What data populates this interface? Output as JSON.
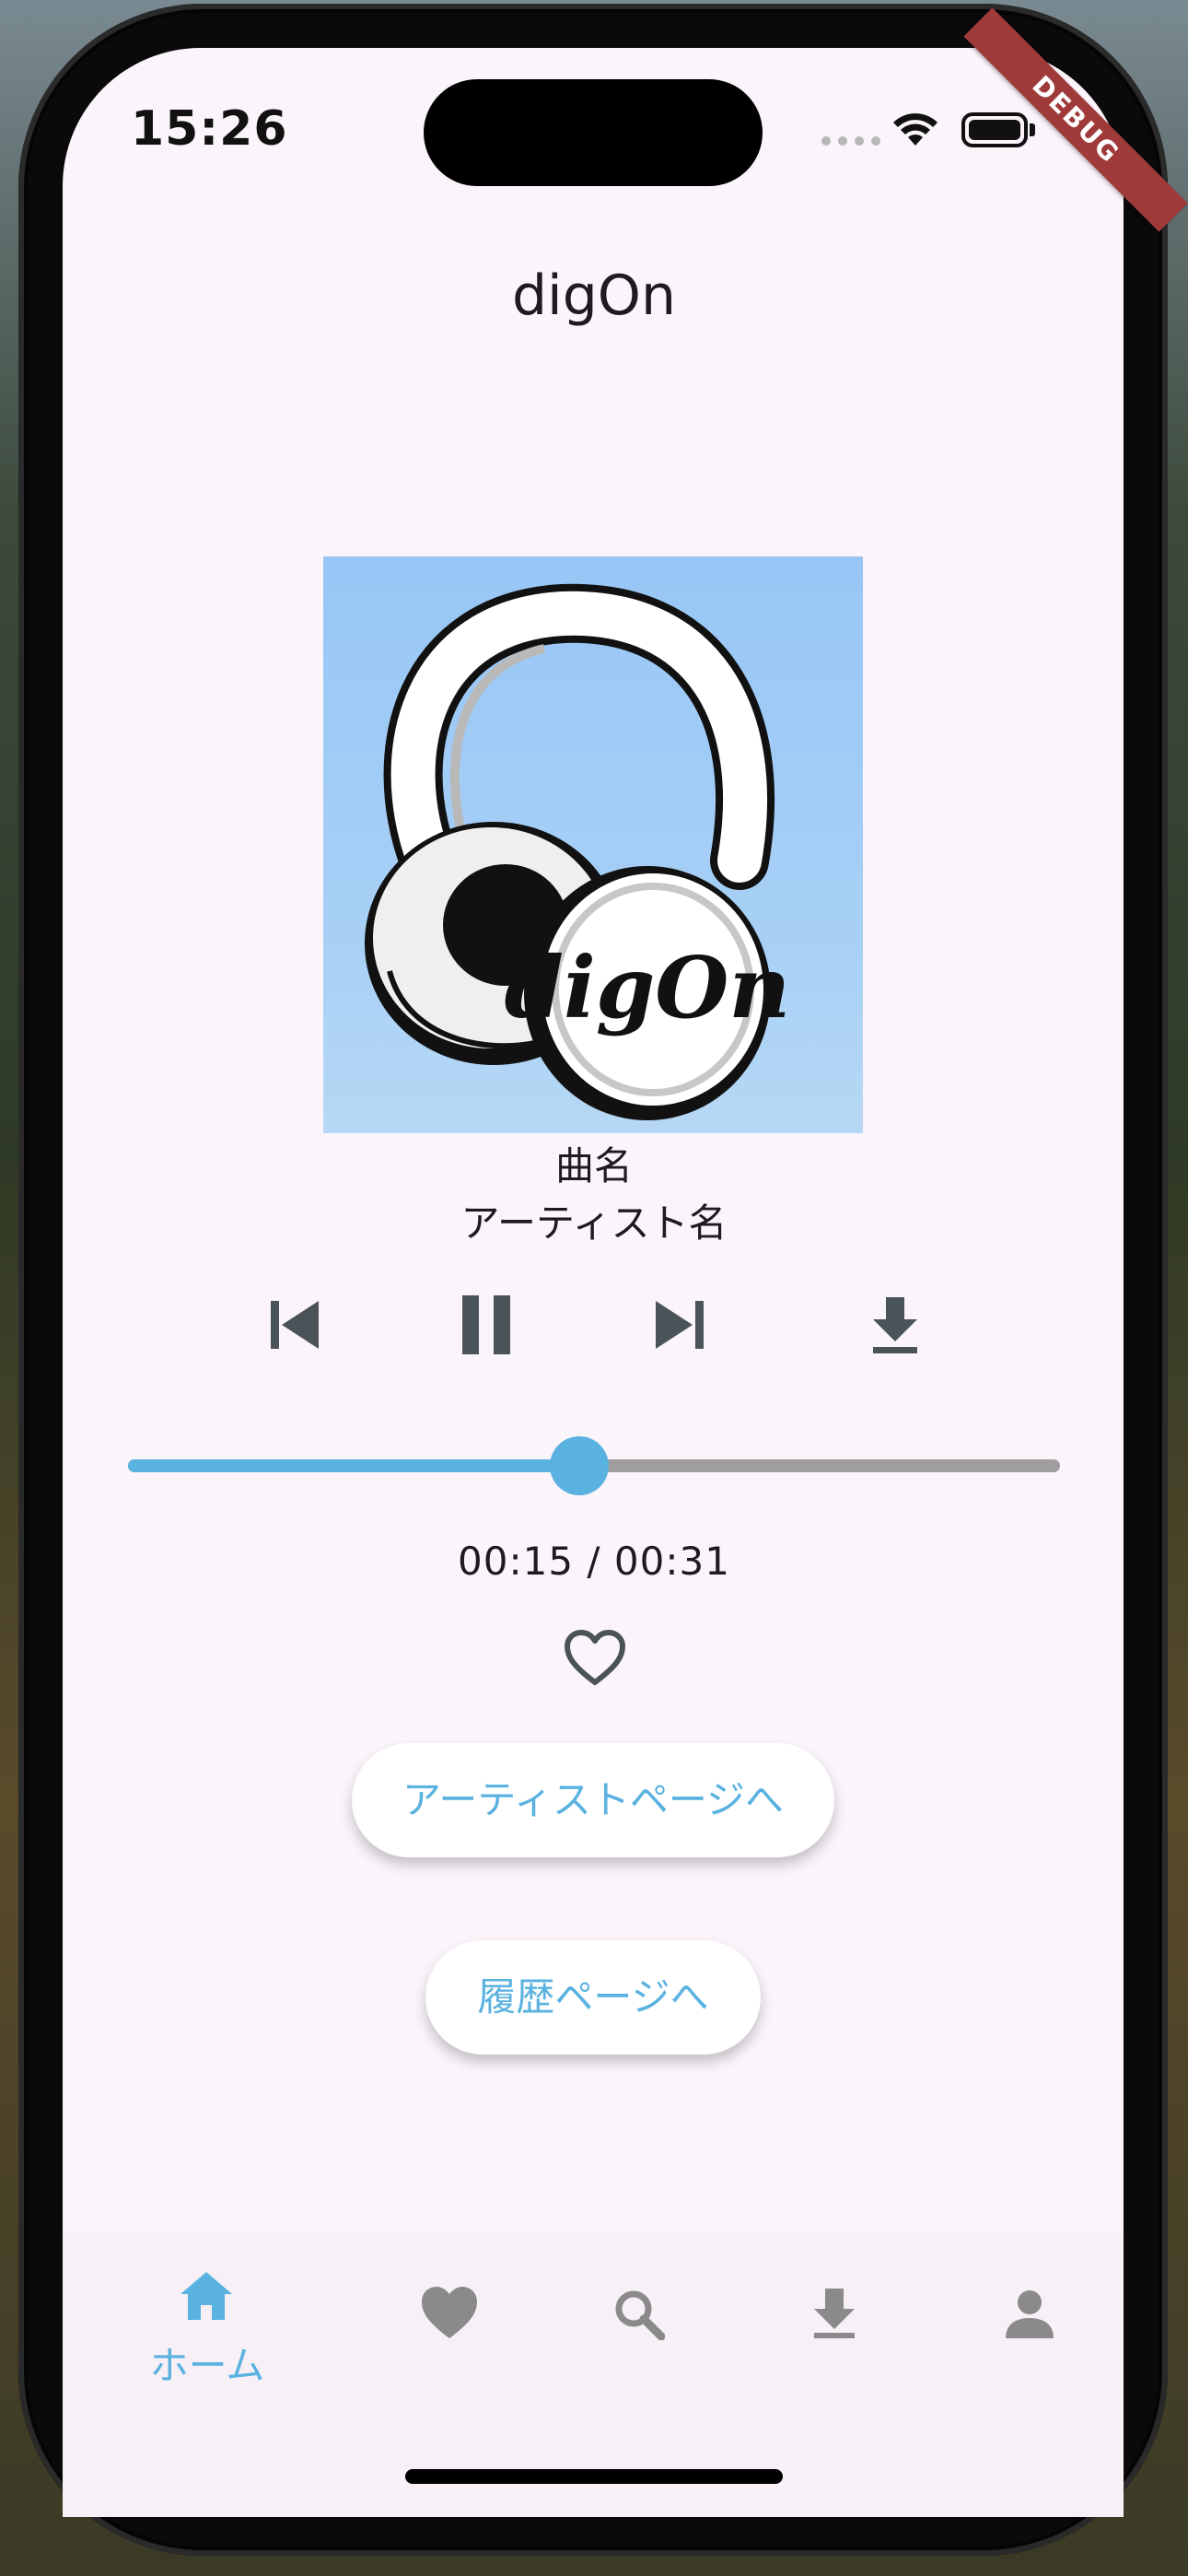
{
  "status_bar": {
    "time": "15:26",
    "debug_label": "DEBUG"
  },
  "app": {
    "title": "digOn"
  },
  "player": {
    "artwork_label": "digOn",
    "song_title": "曲名",
    "artist_name": "アーティスト名",
    "elapsed": "00:15",
    "duration": "00:31",
    "time_display": "00:15 / 00:31",
    "progress": 0.484,
    "favorited": false
  },
  "buttons": {
    "artist_page": "アーティストページへ",
    "history_page": "履歴ページへ"
  },
  "bottom_nav": {
    "items": [
      {
        "label": "ホーム",
        "icon": "home-icon",
        "active": true
      },
      {
        "icon": "heart-icon",
        "active": false
      },
      {
        "icon": "search-icon",
        "active": false
      },
      {
        "icon": "download-icon",
        "active": false
      },
      {
        "icon": "person-icon",
        "active": false
      }
    ]
  },
  "colors": {
    "accent": "#5ab2e0",
    "inactive_icon": "#8a8a8a",
    "control_icon": "#4a5358",
    "background": "#fbf5fb"
  }
}
